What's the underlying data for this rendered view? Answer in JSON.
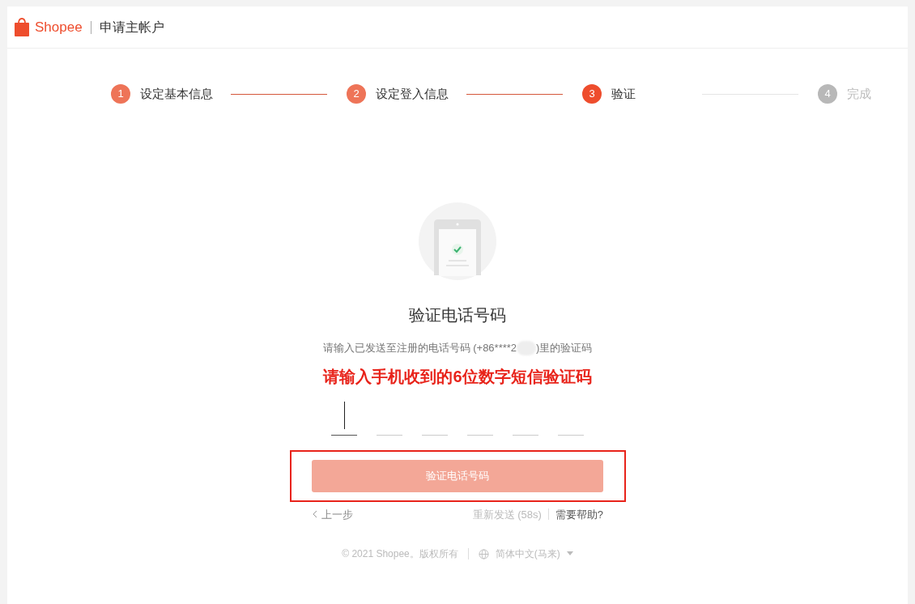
{
  "header": {
    "logo_text": "Shopee",
    "title": "申请主帐户"
  },
  "steps": [
    {
      "number": "1",
      "label": "设定基本信息",
      "done": true,
      "current": false
    },
    {
      "number": "2",
      "label": "设定登入信息",
      "done": true,
      "current": false
    },
    {
      "number": "3",
      "label": "验证",
      "done": false,
      "current": true
    },
    {
      "number": "4",
      "label": "完成",
      "done": false,
      "current": false
    }
  ],
  "verify": {
    "title": "验证电话号码",
    "instruction_before": "请输入已发送至注册的电话号码 (+86****2",
    "instruction_after": ")里的验证码",
    "annotation": "请输入手机收到的6位数字短信验证码",
    "code_slots": [
      {
        "focused": true
      },
      {
        "focused": false
      },
      {
        "focused": false
      },
      {
        "focused": false
      },
      {
        "focused": false
      },
      {
        "focused": false
      }
    ],
    "submit": {
      "label": "验证电话号码",
      "disabled": true,
      "highlighted": true
    },
    "back": "上一步",
    "resend": "重新发送 (58s)",
    "help": "需要帮助?"
  },
  "footer": {
    "copyright": "© 2021 Shopee。版权所有",
    "language": "简体中文(马来)"
  }
}
